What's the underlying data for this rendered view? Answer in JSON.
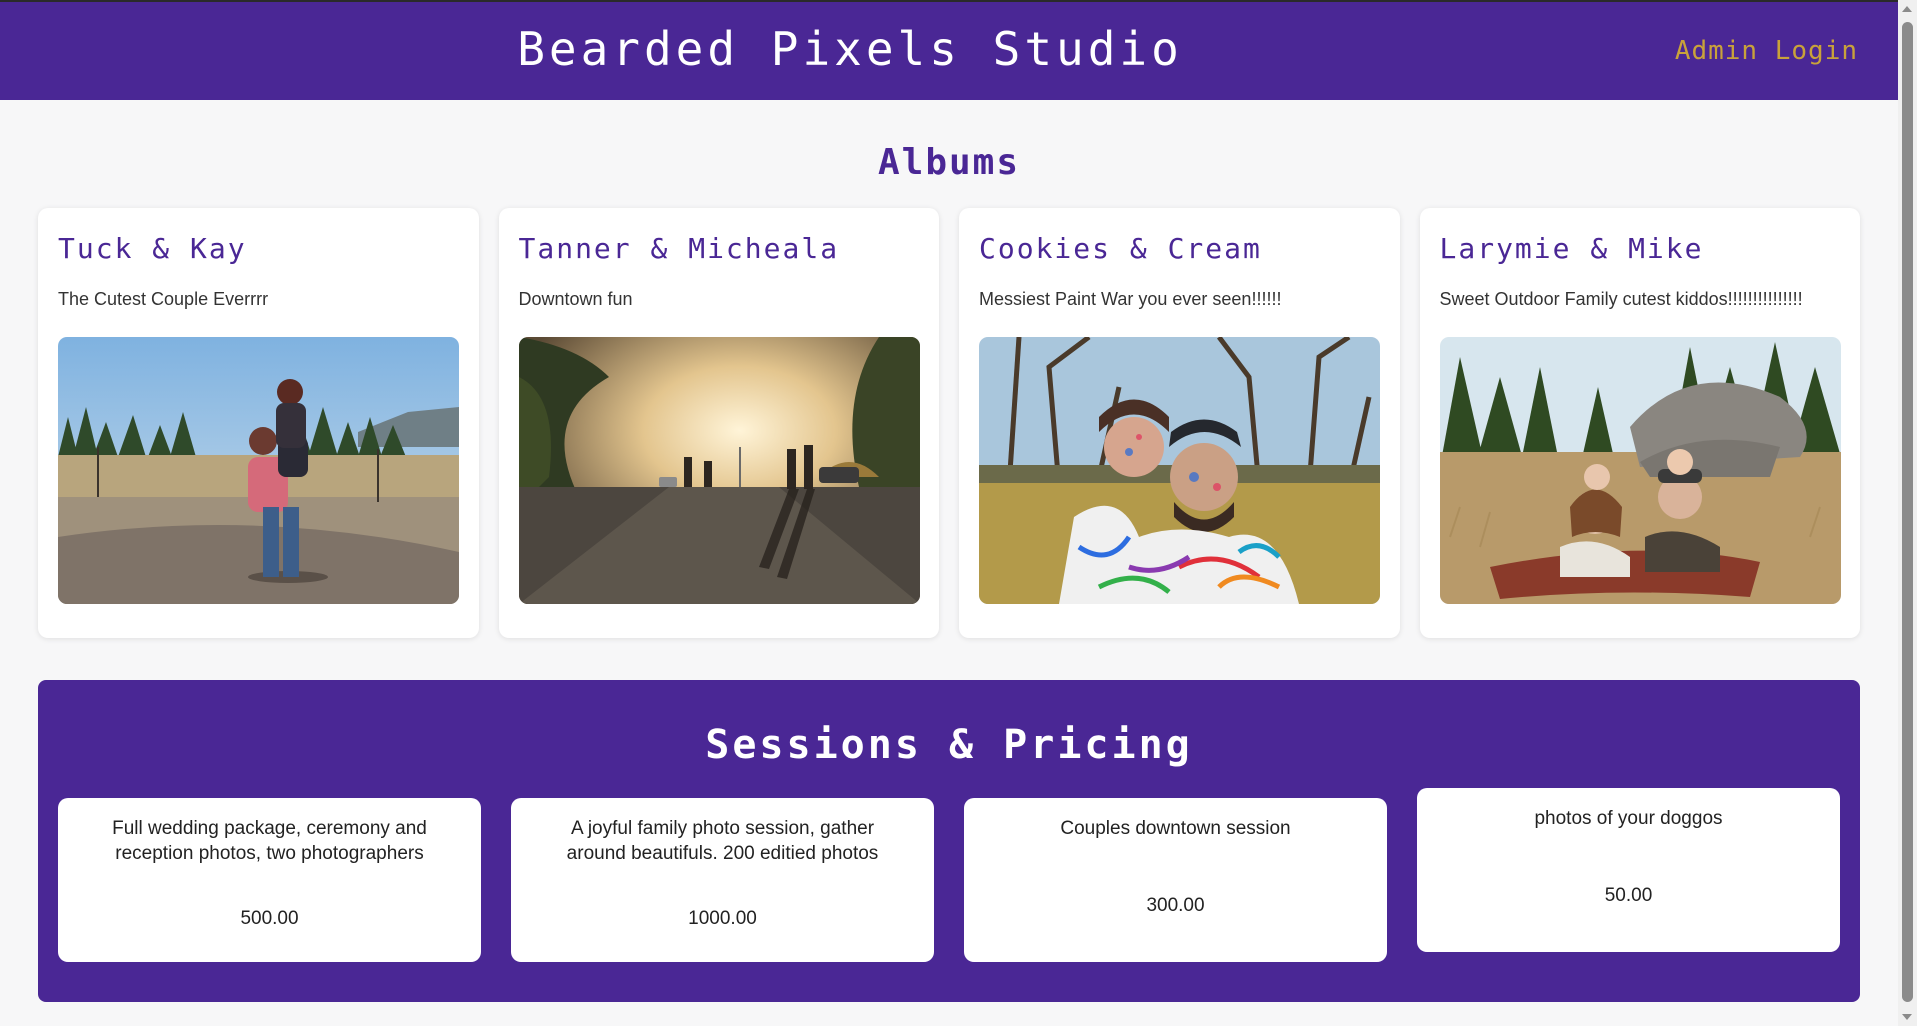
{
  "header": {
    "title": "Bearded Pixels Studio",
    "admin_login": "Admin Login"
  },
  "albums": {
    "heading": "Albums",
    "items": [
      {
        "title": "Tuck & Kay",
        "description": "The Cutest Couple Everrrr"
      },
      {
        "title": "Tanner & Micheala",
        "description": "Downtown fun"
      },
      {
        "title": "Cookies & Cream",
        "description": "Messiest Paint War you ever seen!!!!!!"
      },
      {
        "title": "Larymie & Mike",
        "description": "Sweet Outdoor Family cutest kiddos!!!!!!!!!!!!!!!"
      }
    ]
  },
  "sessions": {
    "heading": "Sessions & Pricing",
    "items": [
      {
        "description": "Full wedding package, ceremony and reception photos, two photographers",
        "price": "500.00"
      },
      {
        "description": "A joyful family photo session, gather around beautifuls. 200 editied photos",
        "price": "1000.00"
      },
      {
        "description": "Couples downtown session",
        "price": "300.00"
      },
      {
        "description": "photos of your doggos",
        "price": "50.00"
      }
    ]
  },
  "colors": {
    "brand_purple": "#4a2795",
    "admin_link_gold": "#c9a23a",
    "page_background": "#f7f7f8"
  }
}
